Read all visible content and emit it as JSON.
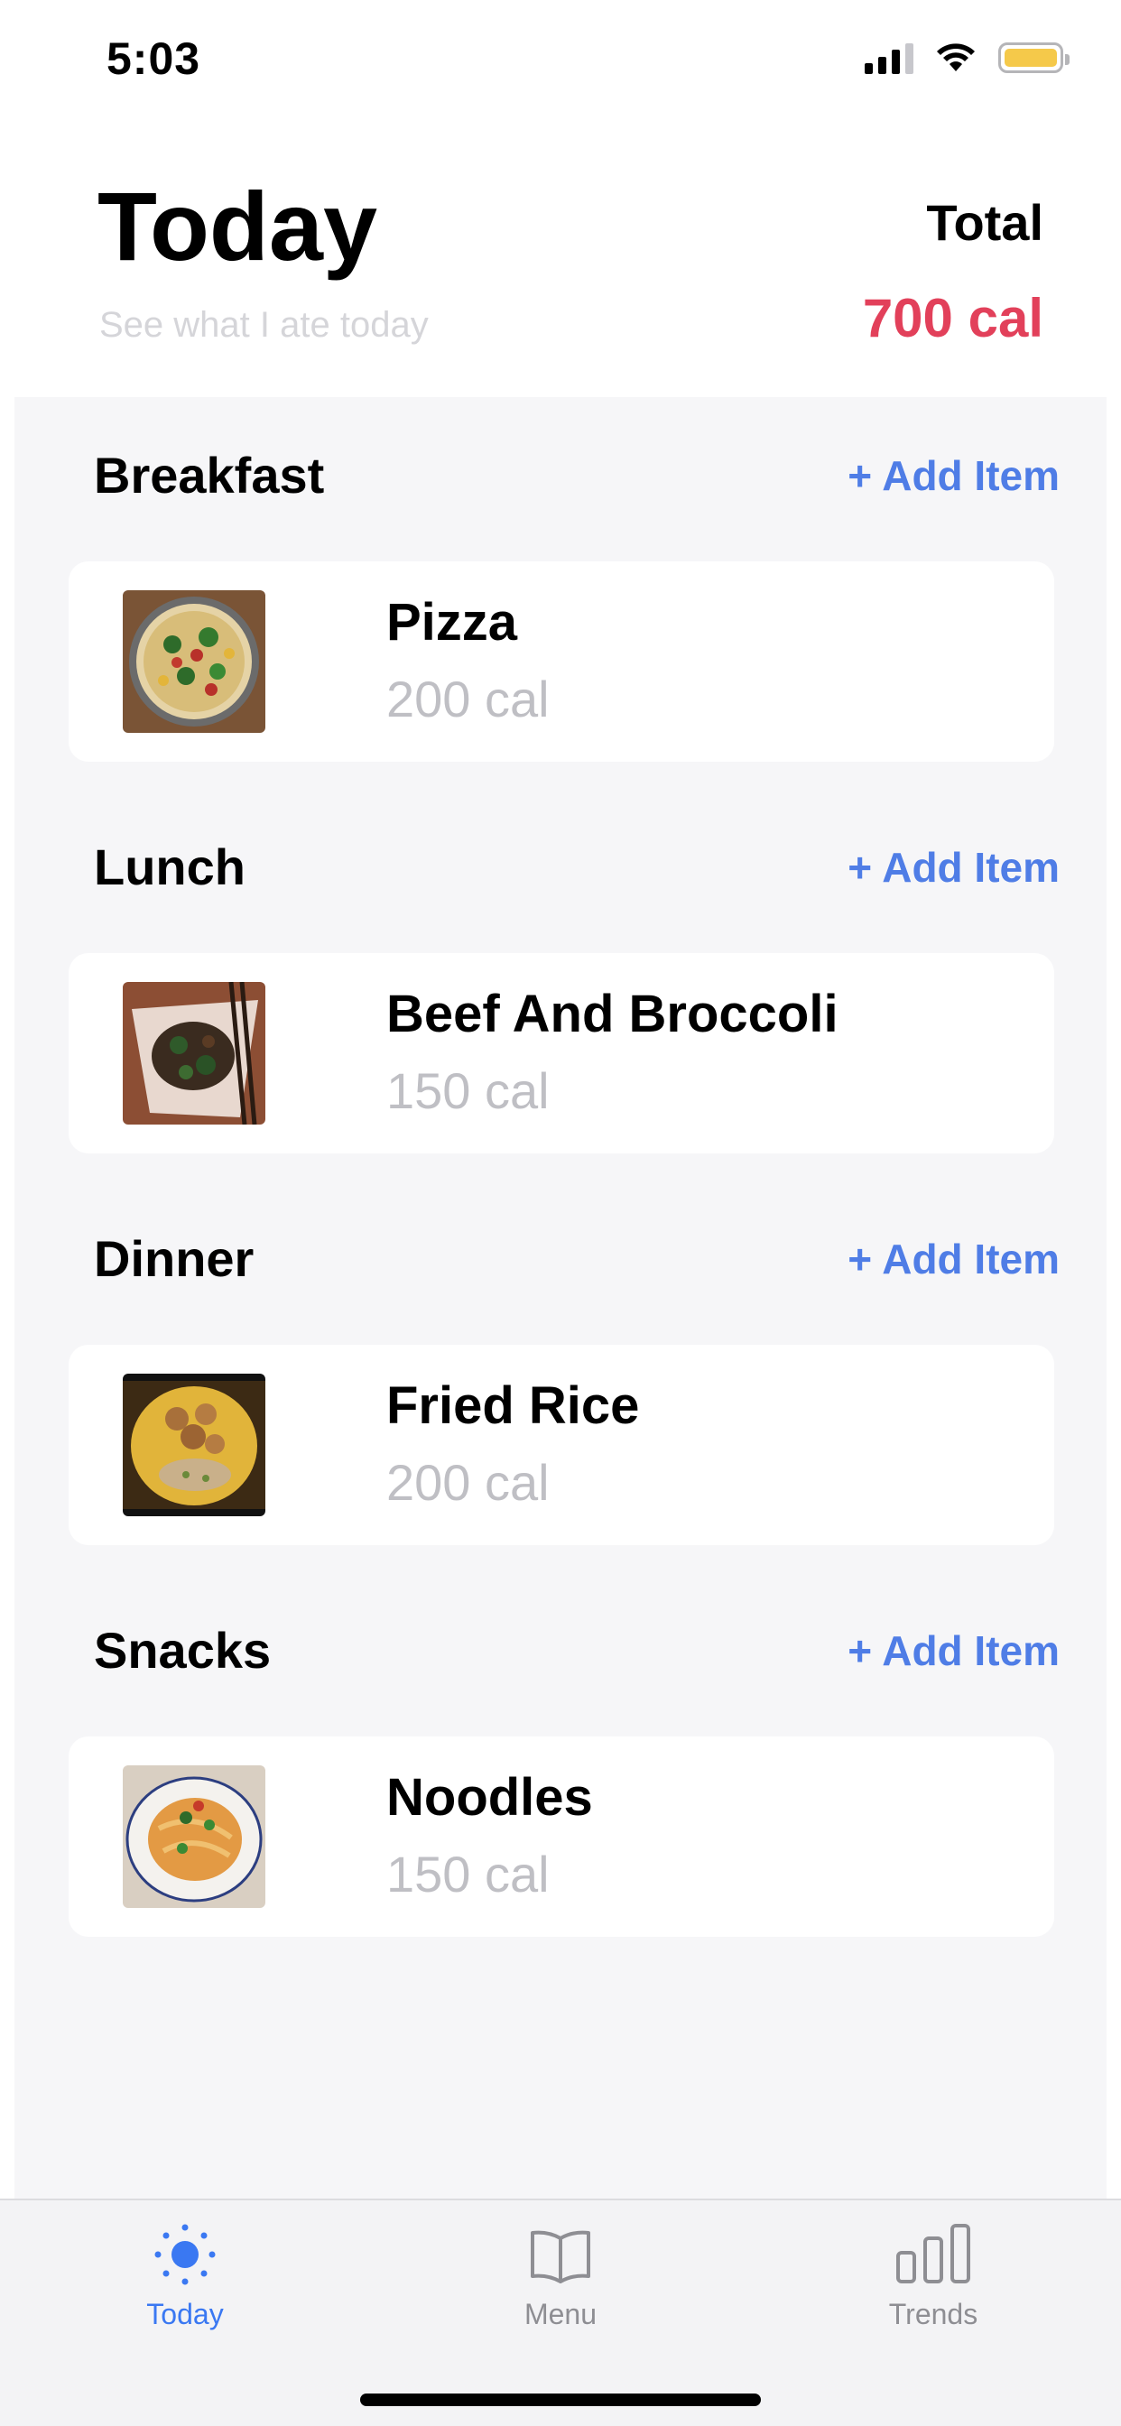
{
  "status_bar": {
    "time": "5:03",
    "icons": [
      "cellular-signal-icon",
      "wifi-icon",
      "battery-icon"
    ],
    "battery_color": "#f5c94a"
  },
  "header": {
    "title": "Today",
    "subtitle": "See what I ate today",
    "total_label": "Total",
    "total_value": "700 cal",
    "total_color": "#e2405a"
  },
  "accent_color": "#4f7de6",
  "meals": [
    {
      "title": "Breakfast",
      "add_label": "+ Add Item",
      "item": {
        "name": "Pizza",
        "calories": "200 cal",
        "image": "pizza-photo"
      }
    },
    {
      "title": "Lunch",
      "add_label": "+ Add Item",
      "item": {
        "name": "Beef And Broccoli",
        "calories": "150 cal",
        "image": "beef-broccoli-photo"
      }
    },
    {
      "title": "Dinner",
      "add_label": "+ Add Item",
      "item": {
        "name": "Fried Rice",
        "calories": "200 cal",
        "image": "fried-rice-photo"
      }
    },
    {
      "title": "Snacks",
      "add_label": "+ Add Item",
      "item": {
        "name": "Noodles",
        "calories": "150 cal",
        "image": "noodles-photo"
      }
    }
  ],
  "tab_bar": {
    "tabs": [
      {
        "label": "Today",
        "icon": "sun-icon",
        "active": true
      },
      {
        "label": "Menu",
        "icon": "book-icon",
        "active": false
      },
      {
        "label": "Trends",
        "icon": "bar-chart-icon",
        "active": false
      }
    ]
  }
}
